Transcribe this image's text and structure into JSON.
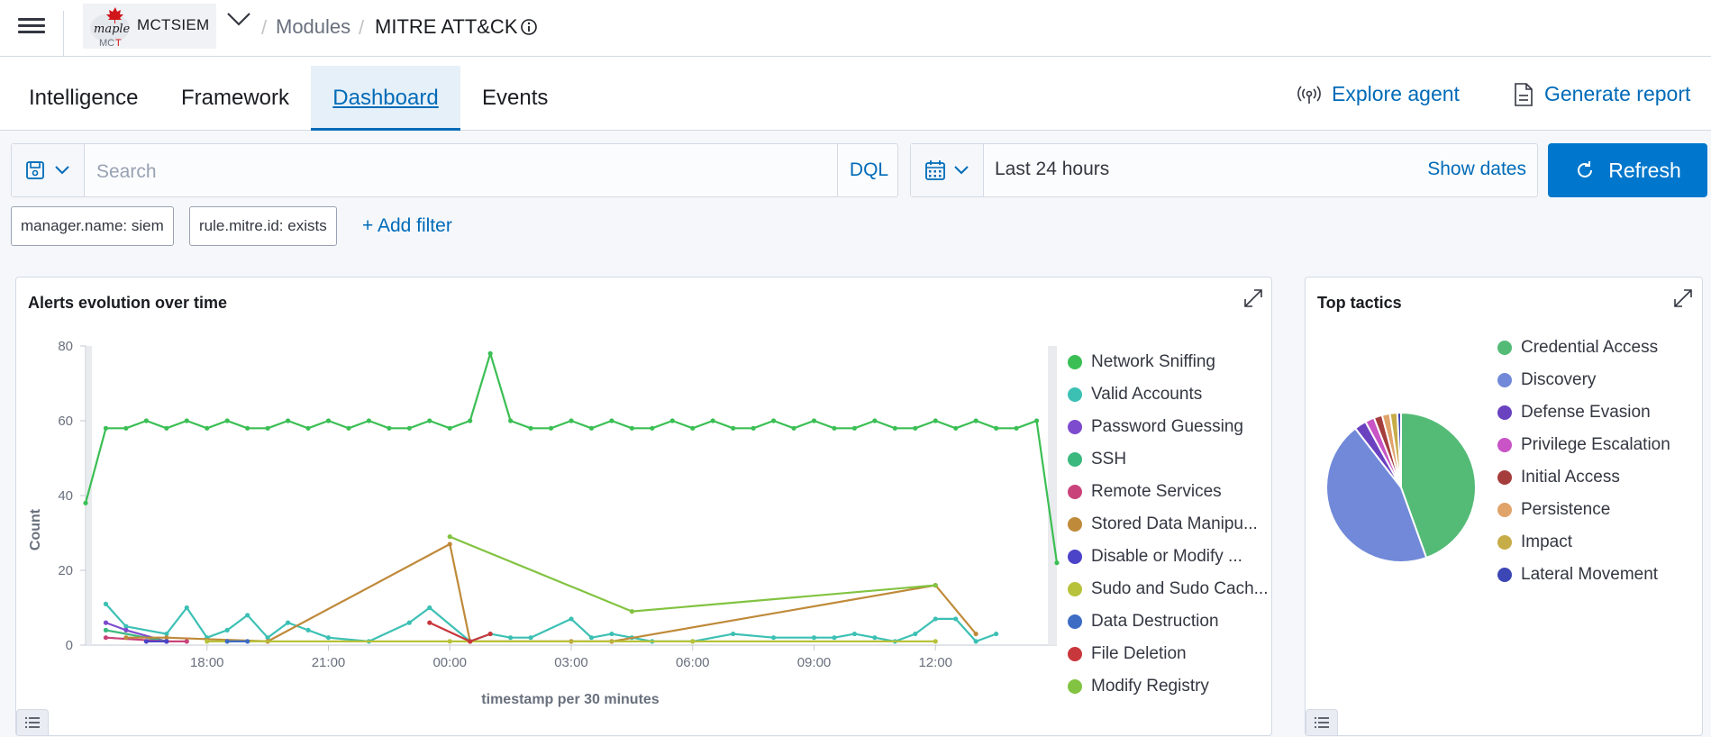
{
  "header": {
    "logo_text": "MCTSIEM",
    "breadcrumb_sep": "/",
    "breadcrumb_modules": "Modules",
    "breadcrumb_current": "MITRE ATT&CK"
  },
  "tabs": [
    "Intelligence",
    "Framework",
    "Dashboard",
    "Events"
  ],
  "active_tab": "Dashboard",
  "actions": {
    "explore_agent": "Explore agent",
    "generate_report": "Generate report"
  },
  "search": {
    "placeholder": "Search",
    "dql": "DQL"
  },
  "date": {
    "range": "Last 24 hours",
    "show_dates": "Show dates",
    "refresh": "Refresh"
  },
  "filters": [
    "manager.name: siem",
    "rule.mitre.id: exists"
  ],
  "add_filter": "+ Add filter",
  "colors": {
    "accent": "#006bb8",
    "button": "#0077cc"
  },
  "chart_data": [
    {
      "type": "line",
      "title": "Alerts evolution over time",
      "xlabel": "timestamp per 30 minutes",
      "ylabel": "Count",
      "ylim": [
        0,
        80
      ],
      "yticks": [
        0,
        20,
        40,
        60,
        80
      ],
      "xticks": [
        "18:00",
        "21:00",
        "00:00",
        "03:00",
        "06:00",
        "09:00",
        "12:00"
      ],
      "x_range_hours": [
        15,
        39
      ],
      "legend_position": "right",
      "series": [
        {
          "name": "Network Sniffing",
          "color": "#3bbf54",
          "x": [
            15,
            15.5,
            16,
            16.5,
            17,
            17.5,
            18,
            18.5,
            19,
            19.5,
            20,
            20.5,
            21,
            21.5,
            22,
            22.5,
            23,
            23.5,
            24,
            24.5,
            25,
            25.5,
            26,
            26.5,
            27,
            27.5,
            28,
            28.5,
            29,
            29.5,
            30,
            30.5,
            31,
            31.5,
            32,
            32.5,
            33,
            33.5,
            34,
            34.5,
            35,
            35.5,
            36,
            36.5,
            37,
            37.5,
            38,
            38.5,
            39
          ],
          "values": [
            38,
            58,
            58,
            60,
            58,
            60,
            58,
            60,
            58,
            58,
            60,
            58,
            60,
            58,
            60,
            58,
            58,
            60,
            58,
            60,
            78,
            60,
            58,
            58,
            60,
            58,
            60,
            58,
            58,
            60,
            58,
            60,
            58,
            58,
            60,
            58,
            60,
            58,
            58,
            60,
            58,
            58,
            60,
            58,
            60,
            58,
            58,
            60,
            22
          ]
        },
        {
          "name": "Valid Accounts",
          "color": "#3cc0b4",
          "x": [
            15.5,
            16,
            17,
            17.5,
            18,
            18.5,
            19,
            19.5,
            20,
            20.5,
            21,
            22,
            23,
            23.5,
            24.5,
            25,
            25.5,
            26,
            27,
            27.5,
            28,
            28.5,
            29,
            30,
            31,
            32,
            33,
            33.5,
            34,
            34.5,
            35,
            35.5,
            36,
            36.5,
            37,
            37.5
          ],
          "values": [
            11,
            5,
            3,
            10,
            2,
            4,
            8,
            2,
            6,
            4,
            2,
            1,
            6,
            10,
            1,
            3,
            2,
            2,
            7,
            2,
            3,
            2,
            1,
            1,
            3,
            2,
            2,
            2,
            3,
            2,
            1,
            3,
            7,
            7,
            1,
            3
          ]
        },
        {
          "name": "Password Guessing",
          "color": "#7d4bce",
          "x": [
            15.5,
            16,
            17
          ],
          "values": [
            6,
            4,
            1
          ]
        },
        {
          "name": "SSH",
          "color": "#3ab87e",
          "x": [
            15.5,
            17
          ],
          "values": [
            4,
            1
          ]
        },
        {
          "name": "Remote Services",
          "color": "#c9437a",
          "x": [
            15.5,
            17,
            17.5
          ],
          "values": [
            2,
            1,
            1
          ]
        },
        {
          "name": "Stored Data Manipulation",
          "color": "#bf8a3a",
          "x": [
            16,
            17,
            19.5,
            24,
            24.5,
            27,
            28,
            36,
            37
          ],
          "values": [
            2,
            2,
            1,
            27,
            1,
            1,
            1,
            16,
            3
          ]
        },
        {
          "name": "Disable or Modify Tools",
          "color": "#4b43c8",
          "x": [
            16.5,
            17
          ],
          "values": [
            1,
            1
          ]
        },
        {
          "name": "Sudo and Sudo Caching",
          "color": "#b8c23a",
          "x": [
            18,
            24,
            30,
            36
          ],
          "values": [
            1,
            1,
            1,
            1
          ]
        },
        {
          "name": "Data Destruction",
          "color": "#3d6cc4",
          "x": [
            18.5,
            19
          ],
          "values": [
            1,
            1
          ]
        },
        {
          "name": "File Deletion",
          "color": "#c8373b",
          "x": [
            23.5,
            24.5,
            25
          ],
          "values": [
            6,
            1,
            3
          ]
        },
        {
          "name": "Modify Registry",
          "color": "#82c341",
          "x": [
            24,
            28.5,
            36
          ],
          "values": [
            29,
            9,
            16
          ]
        }
      ]
    },
    {
      "type": "pie",
      "title": "Top tactics",
      "legend_position": "right",
      "categories": [
        "Credential Access",
        "Discovery",
        "Defense Evasion",
        "Privilege Escalation",
        "Initial Access",
        "Persistence",
        "Impact",
        "Lateral Movement"
      ],
      "values": [
        44.5,
        45.0,
        2.6,
        2.0,
        1.8,
        1.7,
        1.6,
        0.8
      ],
      "colors": [
        "#54bb77",
        "#7189d8",
        "#6a42c0",
        "#c854c6",
        "#a53d3d",
        "#e0a36a",
        "#c7ad48",
        "#3c46b5"
      ]
    }
  ]
}
